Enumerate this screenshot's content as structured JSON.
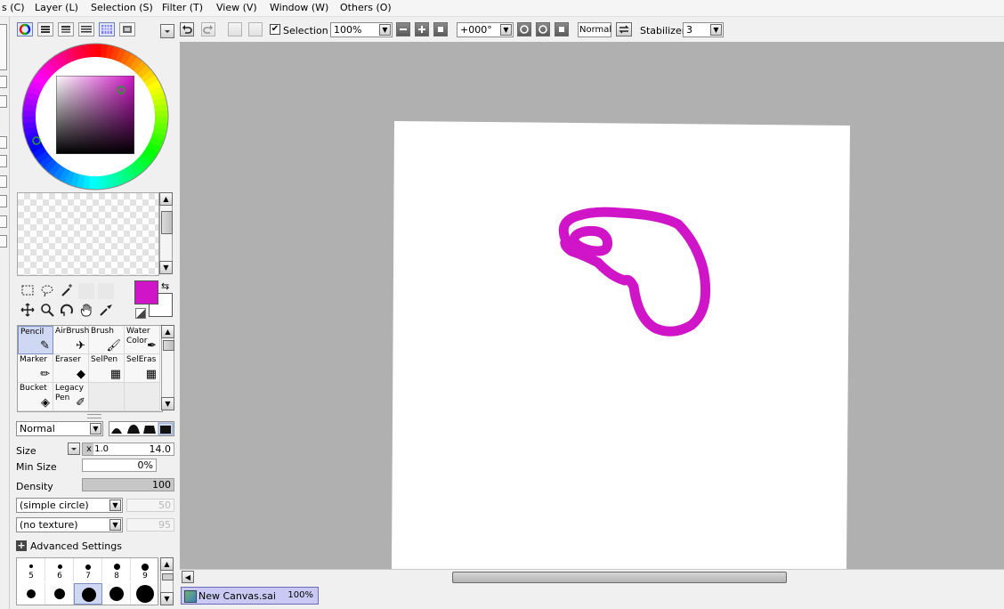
{
  "menu": [
    "s (C)",
    "Layer (L)",
    "Selection (S)",
    "Filter (T)",
    "View (V)",
    "Window (W)",
    "Others (O)"
  ],
  "colors": {
    "primary": "#d015c8",
    "secondary": "#ffffff",
    "stroke": "#d015c8"
  },
  "color_panel": {
    "mode_icons": [
      "color-wheel-icon",
      "rgb-slider-icon",
      "hsv-slider-icon",
      "swatches-icon",
      "grid-palette-icon",
      "scratchpad-icon"
    ]
  },
  "tools": {
    "selection_row": [
      "rect-select-icon",
      "lasso-select-icon",
      "magic-wand-icon"
    ],
    "nav_row": [
      "move-icon",
      "zoom-icon",
      "rotate-icon",
      "hand-icon",
      "eyedropper-icon"
    ]
  },
  "brushes": [
    {
      "label": "Pencil",
      "icon": "✎",
      "selected": true
    },
    {
      "label": "AirBrush",
      "icon": "✈",
      "selected": false
    },
    {
      "label": "Brush",
      "icon": "🖌",
      "selected": false
    },
    {
      "label": "Water Color",
      "icon": "✒",
      "selected": false
    },
    {
      "label": "Marker",
      "icon": "✏",
      "selected": false
    },
    {
      "label": "Eraser",
      "icon": "◆",
      "selected": false
    },
    {
      "label": "SelPen",
      "icon": "▦",
      "selected": false
    },
    {
      "label": "SelEras",
      "icon": "▦",
      "selected": false
    },
    {
      "label": "Bucket",
      "icon": "◈",
      "selected": false
    },
    {
      "label": "Legacy Pen",
      "icon": "✐",
      "selected": false
    }
  ],
  "brush_settings": {
    "blend_mode": "Normal",
    "size_label": "Size",
    "size_multiplier": "x 1.0",
    "size_value": "14.0",
    "min_size_label": "Min Size",
    "min_size_value": "0%",
    "density_label": "Density",
    "density_value": "100",
    "shape": "(simple circle)",
    "shape_value": "50",
    "texture": "(no texture)",
    "texture_value": "95",
    "advanced_label": "Advanced Settings"
  },
  "size_presets": {
    "labels": [
      "5",
      "6",
      "7",
      "8",
      "9"
    ],
    "selected_index": 2
  },
  "toolbar": {
    "selection_label": "Selection",
    "selection_checked": true,
    "zoom": "100%",
    "angle": "+000°",
    "blend": "Normal",
    "stabilizer_label": "Stabilizer",
    "stabilizer_value": "3"
  },
  "status": {
    "doc_name": "New Canvas.sai",
    "doc_zoom": "100%"
  }
}
